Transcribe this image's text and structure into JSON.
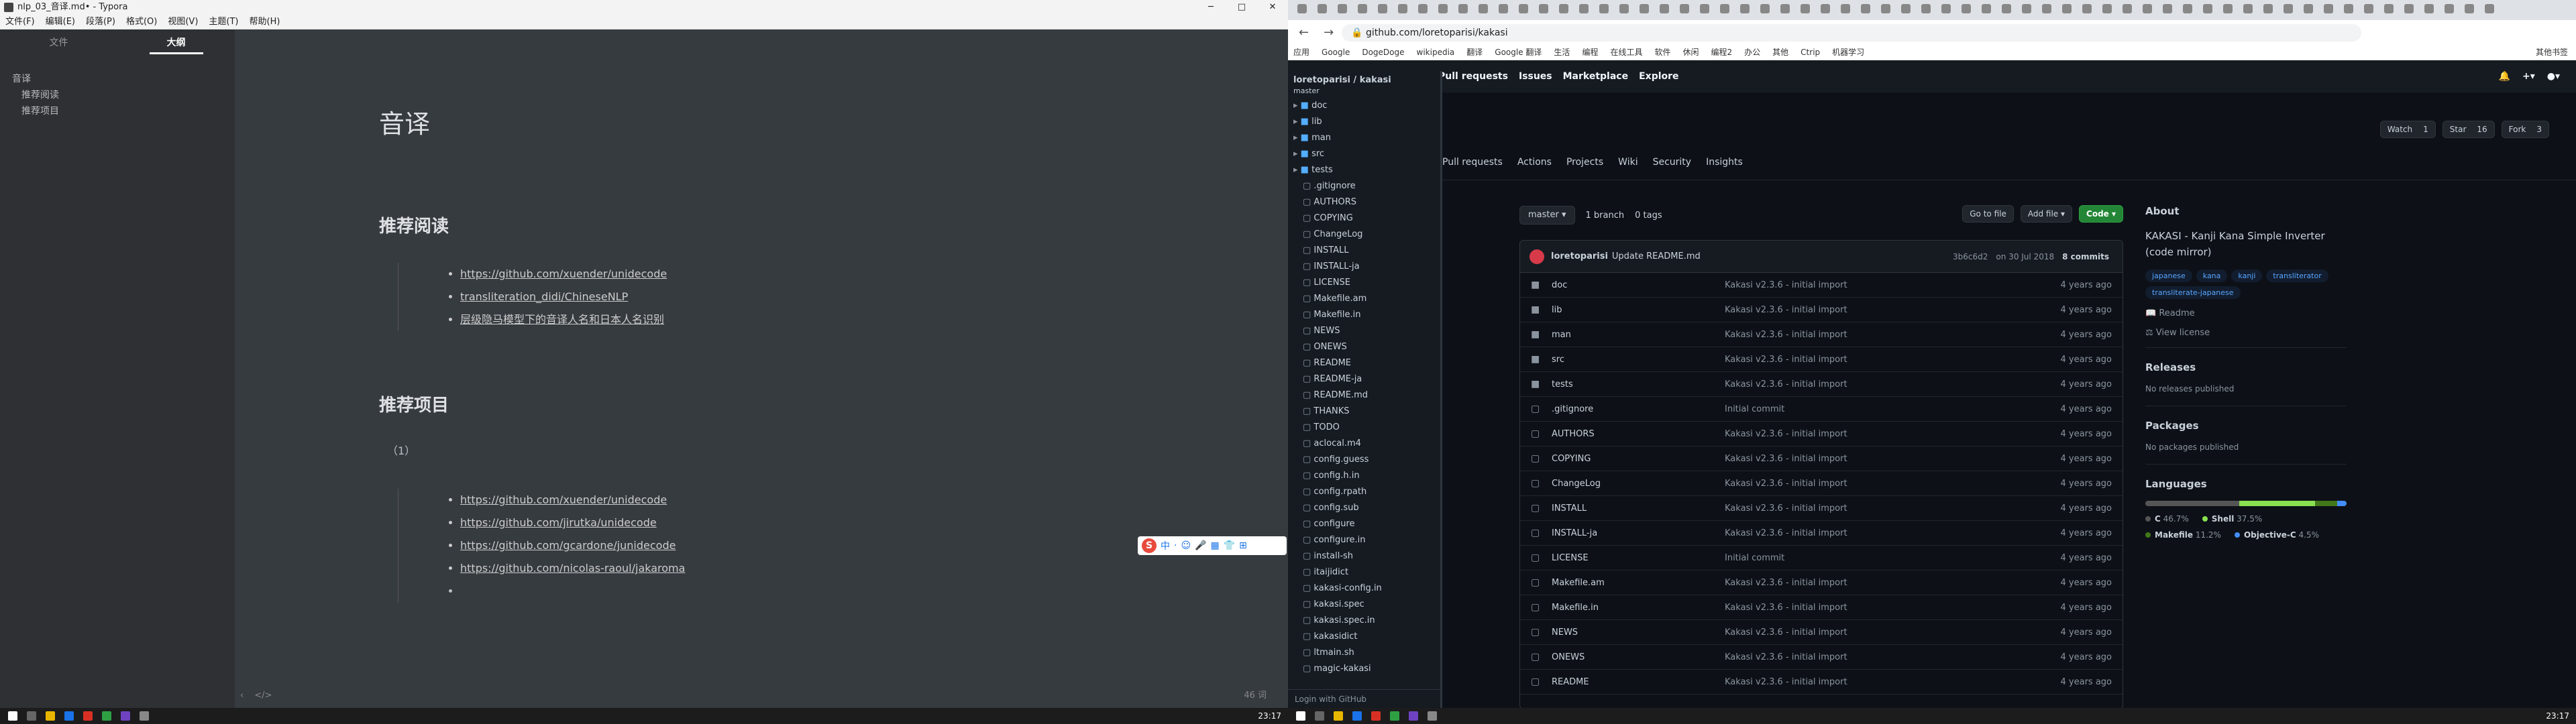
{
  "typora": {
    "title": "nlp_03_音译.md• - Typora",
    "window_buttons": [
      "─",
      "□",
      "✕"
    ],
    "menu": [
      "文件(F)",
      "编辑(E)",
      "段落(P)",
      "格式(O)",
      "视图(V)",
      "主题(T)",
      "帮助(H)"
    ],
    "tabs": {
      "files": "文件",
      "outline": "大纲"
    },
    "outline": [
      {
        "label": "音译",
        "level": 1
      },
      {
        "label": "推荐阅读",
        "level": 2
      },
      {
        "label": "推荐项目",
        "level": 2
      }
    ],
    "doc": {
      "h1": "音译",
      "section1_title": "推荐阅读",
      "section1_items": [
        "https://github.com/xuender/unidecode",
        "transliteration_didi/ChineseNLP",
        "层级隐马模型下的音译人名和日本人名识别"
      ],
      "section2_title": "推荐项目",
      "section2_para": "（1）",
      "section2_items": [
        "https://github.com/xuender/unidecode",
        "https://github.com/jirutka/unidecode",
        "https://github.com/gcardone/junidecode",
        "https://github.com/nicolas-raoul/jakaroma",
        ""
      ]
    },
    "status": {
      "wordcount": "46 词",
      "back": "‹",
      "source": "</>"
    },
    "ime": {
      "logo": "S",
      "items": [
        "中",
        "·",
        "☺",
        "🎤",
        "▦",
        "👕",
        "⊞"
      ]
    }
  },
  "chrome": {
    "url": "github.com/loretoparisi/kakasi",
    "bookmarks": [
      "应用",
      "Google",
      "DogeDoge",
      "wikipedia",
      "翻译",
      "Google 翻译",
      "生活",
      "编程",
      "在线工具",
      "软件",
      "休闲",
      "编程2",
      "办公",
      "其他",
      "Ctrip",
      "机器学习"
    ],
    "other_bookmarks": "其他书签"
  },
  "github": {
    "nav": [
      "Pull requests",
      "Issues",
      "Marketplace",
      "Explore"
    ],
    "watch": {
      "label": "Watch",
      "count": "1"
    },
    "star": {
      "label": "Star",
      "count": "16"
    },
    "fork": {
      "label": "Fork",
      "count": "3"
    },
    "repo_tabs": [
      "Pull requests",
      "Actions",
      "Projects",
      "Wiki",
      "Security",
      "Insights"
    ],
    "branch": "master",
    "branches": "1 branch",
    "tags": "0 tags",
    "goto_file": "Go to file",
    "add_file": "Add file ▾",
    "code_btn": "Code ▾",
    "commit": {
      "author": "loretoparisi",
      "message": "Update README.md",
      "hash": "3b6c6d2",
      "date": "on 30 Jul 2018",
      "commits": "8 commits"
    },
    "files": [
      {
        "name": "doc",
        "type": "dir",
        "msg": "Kakasi v2.3.6 - initial import",
        "age": "4 years ago"
      },
      {
        "name": "lib",
        "type": "dir",
        "msg": "Kakasi v2.3.6 - initial import",
        "age": "4 years ago"
      },
      {
        "name": "man",
        "type": "dir",
        "msg": "Kakasi v2.3.6 - initial import",
        "age": "4 years ago"
      },
      {
        "name": "src",
        "type": "dir",
        "msg": "Kakasi v2.3.6 - initial import",
        "age": "4 years ago"
      },
      {
        "name": "tests",
        "type": "dir",
        "msg": "Kakasi v2.3.6 - initial import",
        "age": "4 years ago"
      },
      {
        "name": ".gitignore",
        "type": "file",
        "msg": "Initial commit",
        "age": "4 years ago"
      },
      {
        "name": "AUTHORS",
        "type": "file",
        "msg": "Kakasi v2.3.6 - initial import",
        "age": "4 years ago"
      },
      {
        "name": "COPYING",
        "type": "file",
        "msg": "Kakasi v2.3.6 - initial import",
        "age": "4 years ago"
      },
      {
        "name": "ChangeLog",
        "type": "file",
        "msg": "Kakasi v2.3.6 - initial import",
        "age": "4 years ago"
      },
      {
        "name": "INSTALL",
        "type": "file",
        "msg": "Kakasi v2.3.6 - initial import",
        "age": "4 years ago"
      },
      {
        "name": "INSTALL-ja",
        "type": "file",
        "msg": "Kakasi v2.3.6 - initial import",
        "age": "4 years ago"
      },
      {
        "name": "LICENSE",
        "type": "file",
        "msg": "Initial commit",
        "age": "4 years ago"
      },
      {
        "name": "Makefile.am",
        "type": "file",
        "msg": "Kakasi v2.3.6 - initial import",
        "age": "4 years ago"
      },
      {
        "name": "Makefile.in",
        "type": "file",
        "msg": "Kakasi v2.3.6 - initial import",
        "age": "4 years ago"
      },
      {
        "name": "NEWS",
        "type": "file",
        "msg": "Kakasi v2.3.6 - initial import",
        "age": "4 years ago"
      },
      {
        "name": "ONEWS",
        "type": "file",
        "msg": "Kakasi v2.3.6 - initial import",
        "age": "4 years ago"
      },
      {
        "name": "README",
        "type": "file",
        "msg": "Kakasi v2.3.6 - initial import",
        "age": "4 years ago"
      }
    ],
    "about": {
      "title": "About",
      "desc": "KAKASI - Kanji Kana Simple Inverter (code mirror)",
      "topics": [
        "japanese",
        "kana",
        "kanji",
        "transliterator",
        "transliterate-japanese"
      ],
      "readme": "Readme",
      "license": "View license",
      "releases_title": "Releases",
      "releases_none": "No releases published",
      "packages_title": "Packages",
      "packages_none": "No packages published",
      "languages_title": "Languages",
      "languages": [
        {
          "name": "C",
          "pct": "46.7%",
          "value": 46.7,
          "color": "#555555"
        },
        {
          "name": "Shell",
          "pct": "37.5%",
          "value": 37.5,
          "color": "#89e051"
        },
        {
          "name": "Makefile",
          "pct": "11.2%",
          "value": 11.2,
          "color": "#427819"
        },
        {
          "name": "Objective-C",
          "pct": "4.5%",
          "value": 4.5,
          "color": "#438eff"
        }
      ]
    }
  },
  "octotree": {
    "repo": "loretoparisi / kakasi",
    "branch": "master",
    "items": [
      {
        "name": "doc",
        "type": "dir"
      },
      {
        "name": "lib",
        "type": "dir"
      },
      {
        "name": "man",
        "type": "dir"
      },
      {
        "name": "src",
        "type": "dir"
      },
      {
        "name": "tests",
        "type": "dir"
      },
      {
        "name": ".gitignore",
        "type": "file"
      },
      {
        "name": "AUTHORS",
        "type": "file"
      },
      {
        "name": "COPYING",
        "type": "file"
      },
      {
        "name": "ChangeLog",
        "type": "file"
      },
      {
        "name": "INSTALL",
        "type": "file"
      },
      {
        "name": "INSTALL-ja",
        "type": "file"
      },
      {
        "name": "LICENSE",
        "type": "file"
      },
      {
        "name": "Makefile.am",
        "type": "file"
      },
      {
        "name": "Makefile.in",
        "type": "file"
      },
      {
        "name": "NEWS",
        "type": "file"
      },
      {
        "name": "ONEWS",
        "type": "file"
      },
      {
        "name": "README",
        "type": "file"
      },
      {
        "name": "README-ja",
        "type": "file"
      },
      {
        "name": "README.md",
        "type": "file"
      },
      {
        "name": "THANKS",
        "type": "file"
      },
      {
        "name": "TODO",
        "type": "file"
      },
      {
        "name": "aclocal.m4",
        "type": "file"
      },
      {
        "name": "config.guess",
        "type": "file"
      },
      {
        "name": "config.h.in",
        "type": "file"
      },
      {
        "name": "config.rpath",
        "type": "file"
      },
      {
        "name": "config.sub",
        "type": "file"
      },
      {
        "name": "configure",
        "type": "file"
      },
      {
        "name": "configure.in",
        "type": "file"
      },
      {
        "name": "install-sh",
        "type": "file"
      },
      {
        "name": "itaijidict",
        "type": "file"
      },
      {
        "name": "kakasi-config.in",
        "type": "file"
      },
      {
        "name": "kakasi.spec",
        "type": "file"
      },
      {
        "name": "kakasi.spec.in",
        "type": "file"
      },
      {
        "name": "kakasidict",
        "type": "file"
      },
      {
        "name": "ltmain.sh",
        "type": "file"
      },
      {
        "name": "magic-kakasi",
        "type": "file"
      }
    ],
    "footer": "Login with GitHub"
  },
  "taskbar": {
    "time": "23:17"
  }
}
